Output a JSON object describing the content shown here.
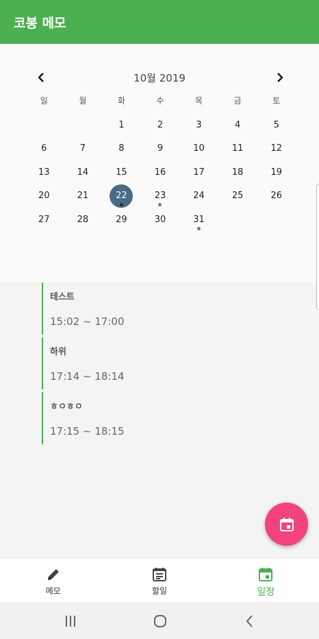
{
  "app": {
    "title": "코봉 메모",
    "accent": "#4caf50"
  },
  "calendar": {
    "month_label": "10월 2019",
    "weekdays": [
      "일",
      "월",
      "화",
      "수",
      "목",
      "금",
      "토"
    ],
    "leading_blanks": 2,
    "days": [
      "1",
      "2",
      "3",
      "4",
      "5",
      "6",
      "7",
      "8",
      "9",
      "10",
      "11",
      "12",
      "13",
      "14",
      "15",
      "16",
      "17",
      "18",
      "19",
      "20",
      "21",
      "22",
      "23",
      "24",
      "25",
      "26",
      "27",
      "28",
      "29",
      "30",
      "31"
    ],
    "selected_day": "22",
    "days_with_events": [
      "22",
      "23",
      "31"
    ],
    "selected_color": "#4a6a85"
  },
  "events": [
    {
      "title": "테스트",
      "time": "15:02 ~ 17:00"
    },
    {
      "title": "하위",
      "time": "17:14 ~ 18:14"
    },
    {
      "title": "ㅎㅇㅎㅇ",
      "time": "17:15 ~ 18:15"
    }
  ],
  "fab": {
    "icon": "calendar-add-icon",
    "color": "#f2437f"
  },
  "bottom_nav": {
    "items": [
      {
        "label": "메모",
        "icon": "pencil-icon"
      },
      {
        "label": "할일",
        "icon": "list-icon"
      },
      {
        "label": "일정",
        "icon": "calendar-icon",
        "active": true
      }
    ]
  },
  "system_nav": {
    "icons": [
      "recent-apps-icon",
      "home-icon",
      "back-icon"
    ]
  }
}
